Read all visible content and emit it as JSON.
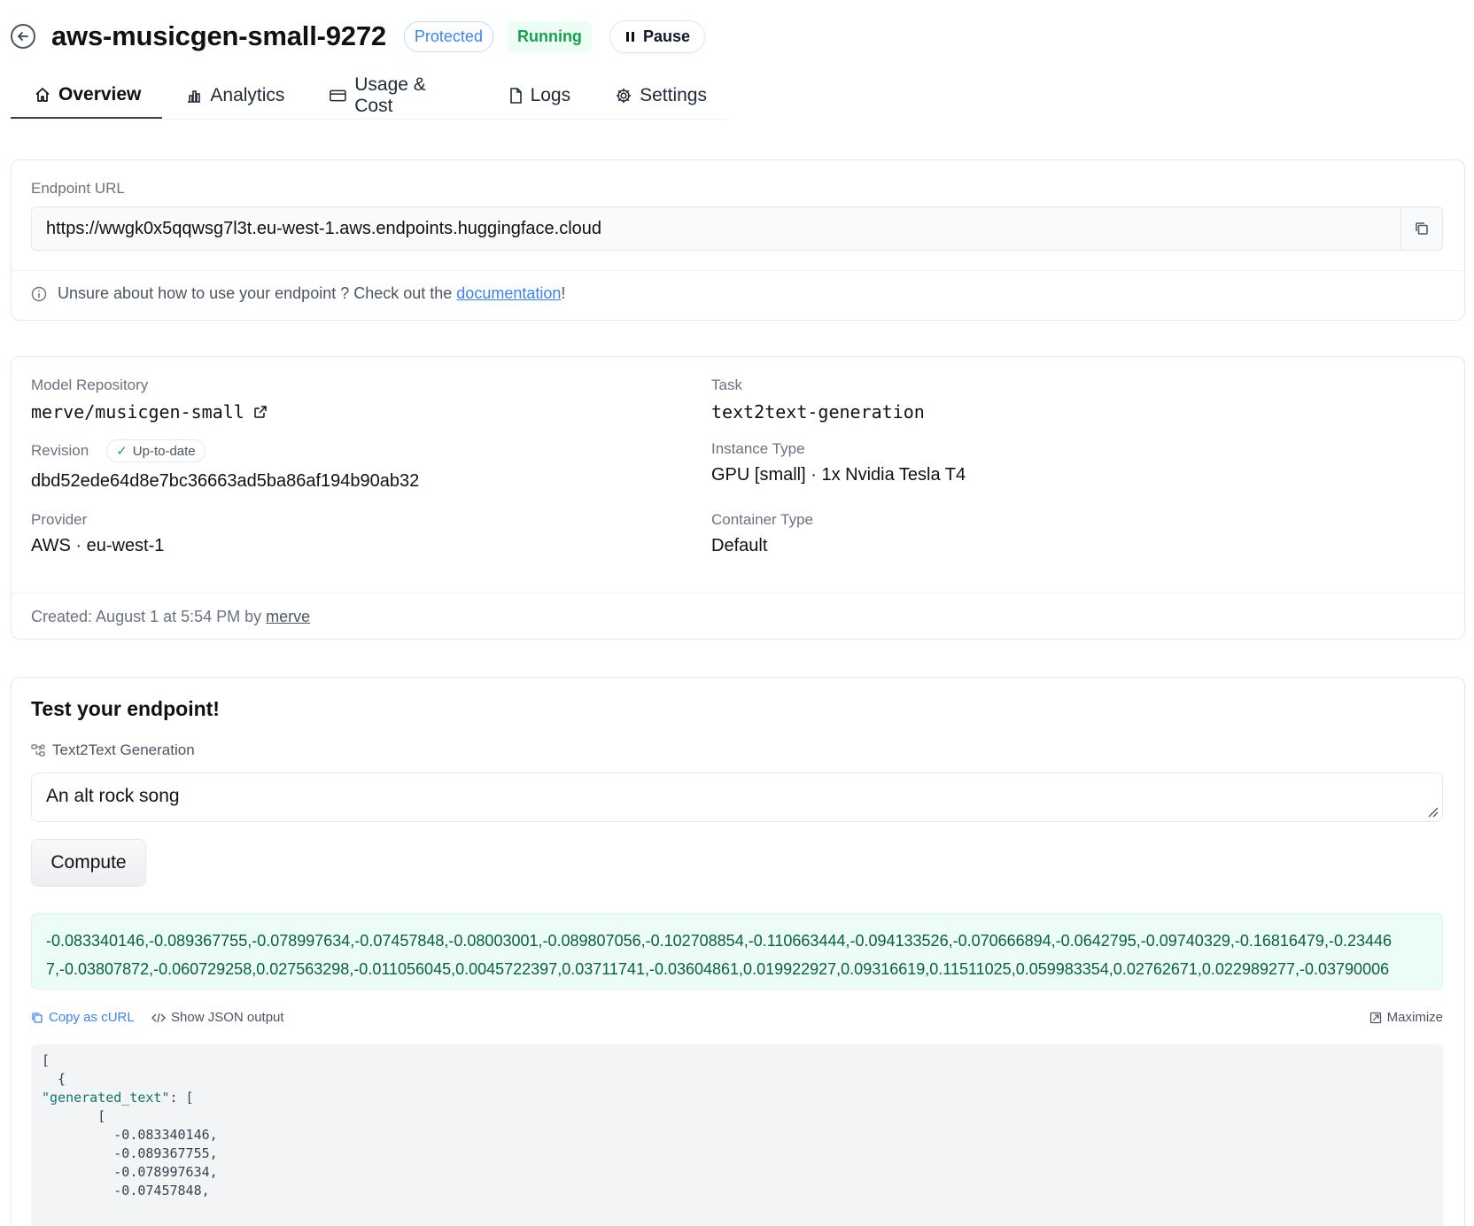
{
  "header": {
    "title": "aws-musicgen-small-9272",
    "protected_label": "Protected",
    "running_label": "Running",
    "pause_label": "Pause"
  },
  "tabs": [
    {
      "label": "Overview",
      "icon": "home-icon",
      "active": true
    },
    {
      "label": "Analytics",
      "icon": "chart-icon"
    },
    {
      "label": "Usage & Cost",
      "icon": "credit-card-icon"
    },
    {
      "label": "Logs",
      "icon": "file-icon"
    },
    {
      "label": "Settings",
      "icon": "gear-icon"
    }
  ],
  "endpoint": {
    "label": "Endpoint URL",
    "url": "https://wwgk0x5qqwsg7l3t.eu-west-1.aws.endpoints.huggingface.cloud",
    "hint_prefix": "Unsure about how to use your endpoint ? Check out the ",
    "hint_link": "documentation",
    "hint_suffix": "!"
  },
  "info": {
    "model_repository_label": "Model Repository",
    "model_repository": "merve/musicgen-small",
    "task_label": "Task",
    "task": "text2text-generation",
    "revision_label": "Revision",
    "revision_badge": "Up-to-date",
    "revision": "dbd52ede64d8e7bc36663ad5ba86af194b90ab32",
    "instance_type_label": "Instance Type",
    "instance_type": "GPU [small] · 1x Nvidia Tesla T4",
    "provider_label": "Provider",
    "provider": "AWS · eu-west-1",
    "container_type_label": "Container Type",
    "container_type": "Default",
    "created_prefix": "Created: August 1 at 5:54 PM by ",
    "created_by": "merve"
  },
  "test": {
    "title": "Test your endpoint!",
    "task_label": "Text2Text Generation",
    "input_value": "An alt rock song",
    "compute_label": "Compute",
    "output_line1": "-0.083340146,-0.089367755,-0.078997634,-0.07457848,-0.08003001,-0.089807056,-0.102708854,-0.110663444,-0.094133526,-0.070666894,-0.0642795,-0.09740329,-0.16816479,-0.23446",
    "output_line2": "7,-0.03807872,-0.060729258,0.027563298,-0.011056045,0.0045722397,0.03711741,-0.03604861,0.019922927,0.09316619,0.11511025,0.059983354,0.02762671,0.022989277,-0.03790006",
    "copy_curl_label": "Copy as cURL",
    "show_json_label": "Show JSON output",
    "maximize_label": "Maximize",
    "json_lines": {
      "l1": "[",
      "l2": "  {",
      "l3_key": "\"generated_text\"",
      "l3_rest": ": [",
      "l4": "       [",
      "l5": "         -0.083340146,",
      "l6": "         -0.089367755,",
      "l7": "         -0.078997634,",
      "l8": "         -0.07457848,"
    }
  }
}
